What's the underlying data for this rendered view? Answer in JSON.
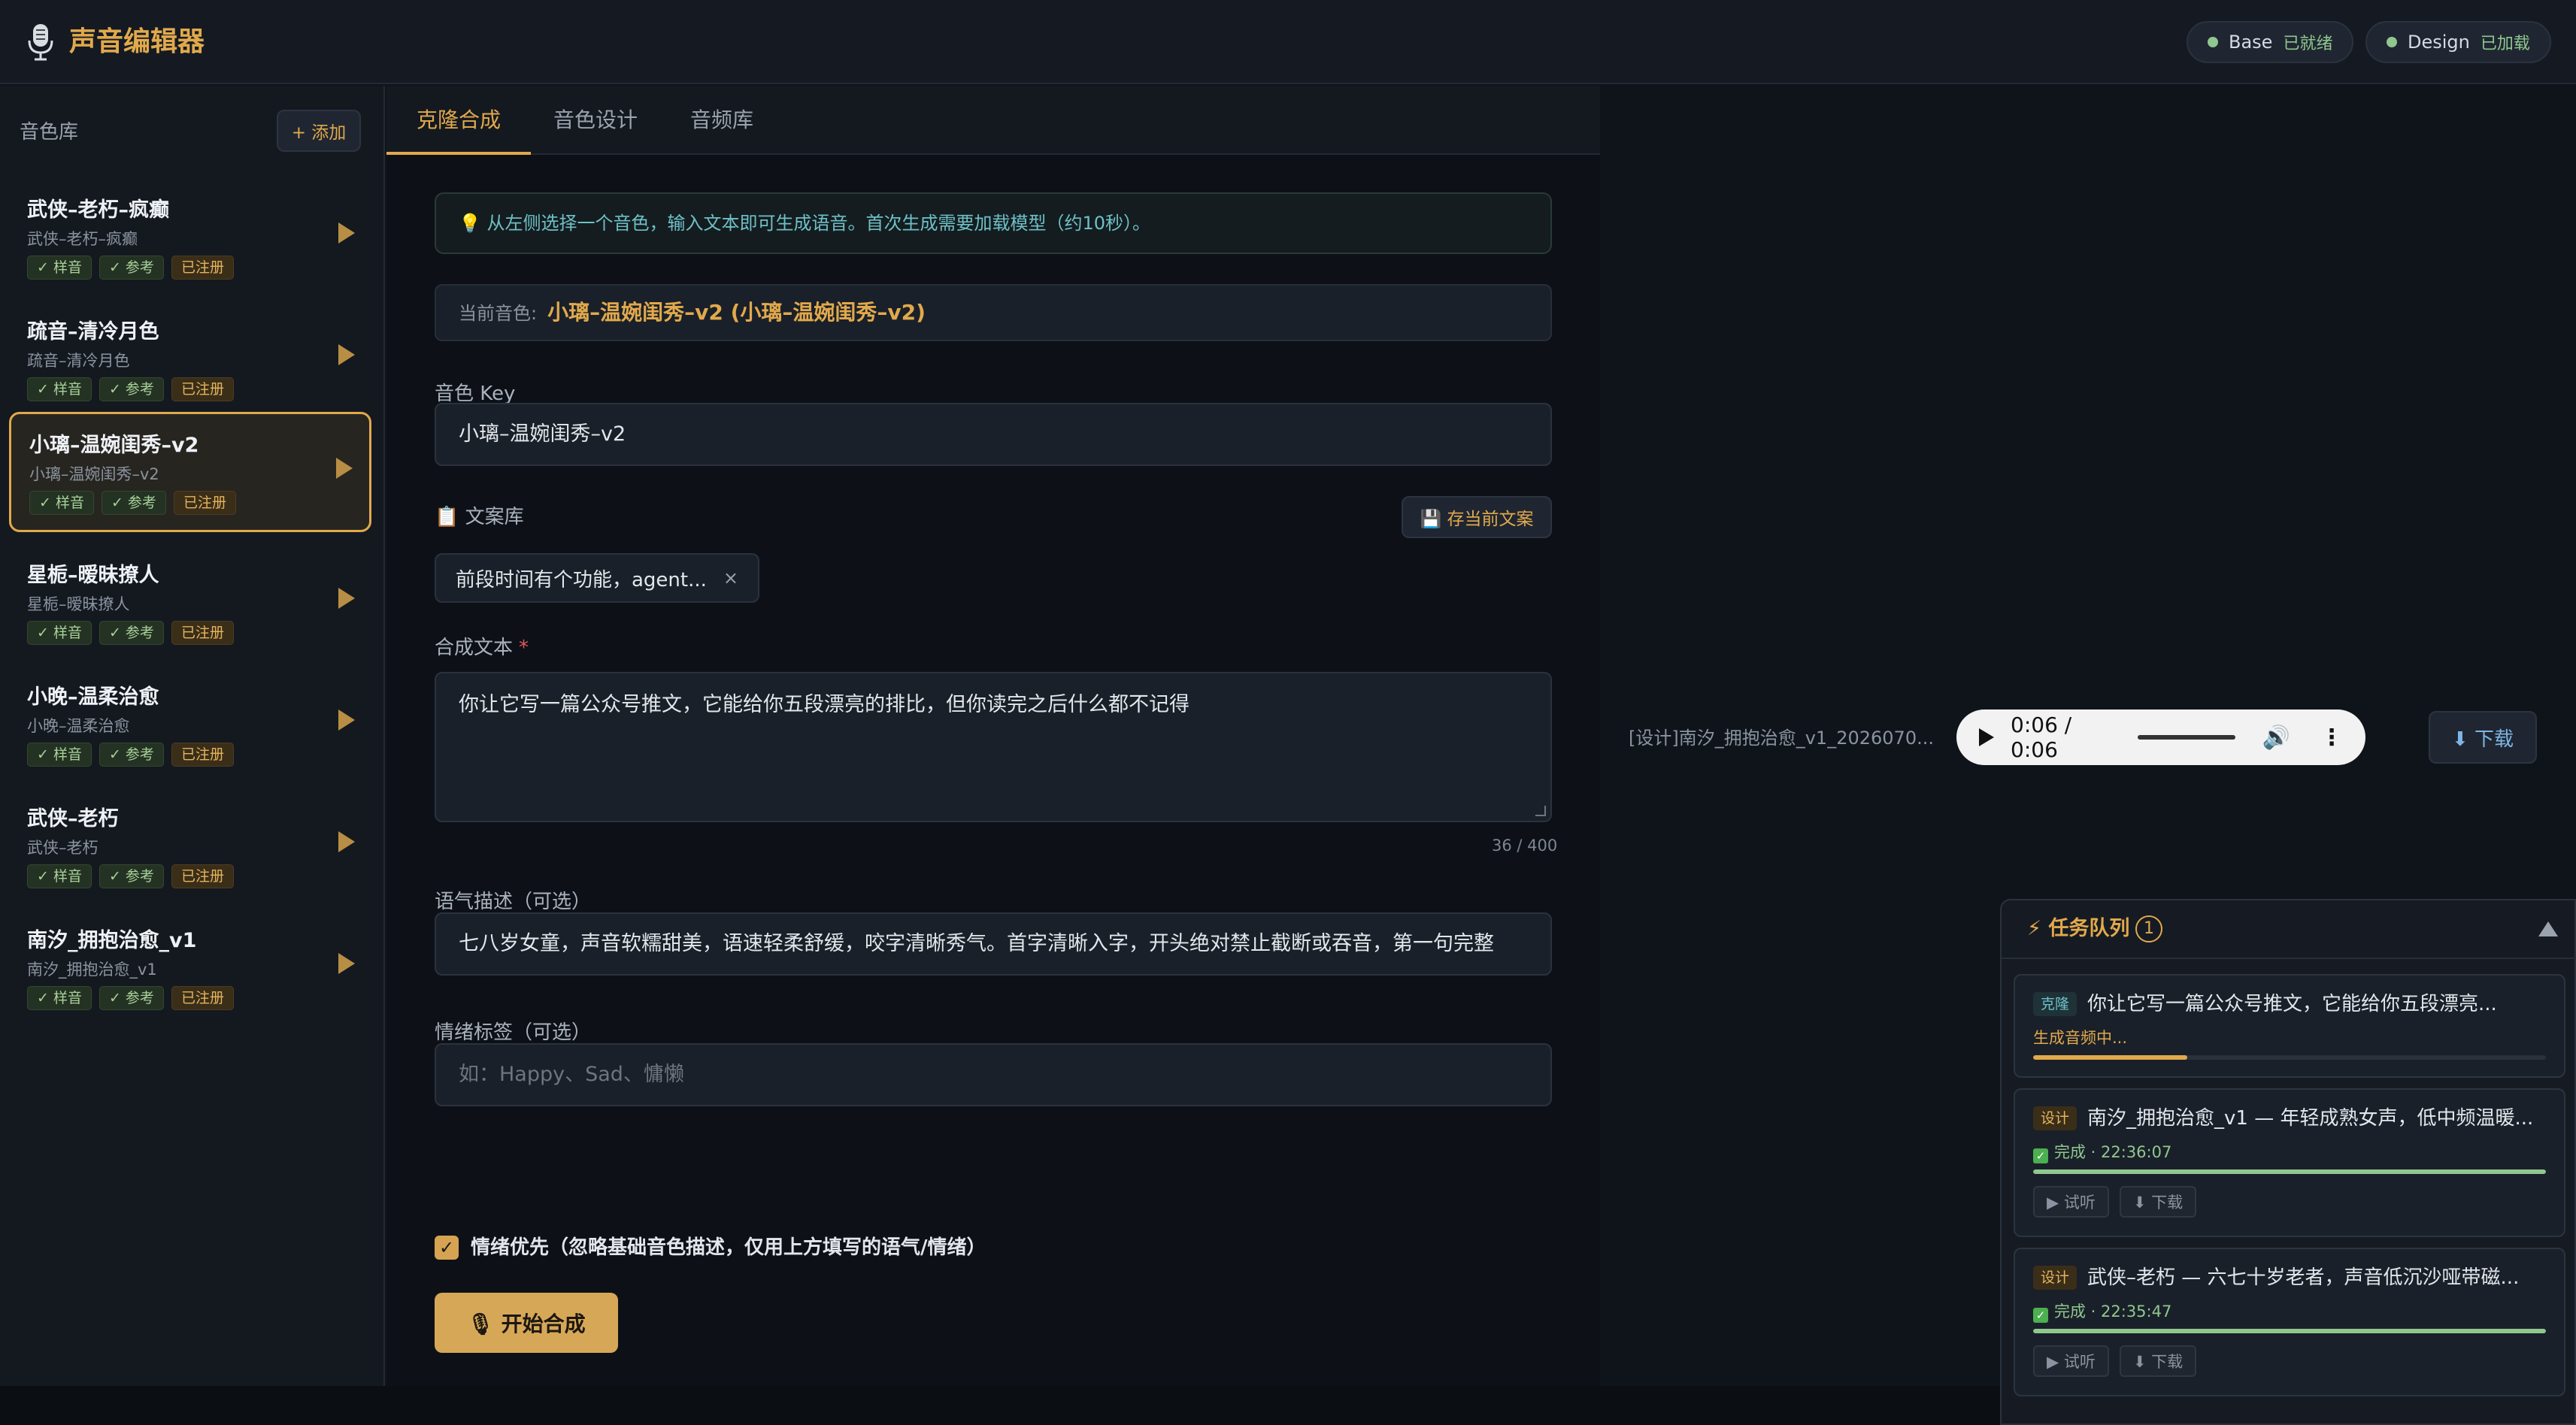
{
  "app": {
    "title": "声音编辑器",
    "logo_icon": "microphone-icon"
  },
  "status": [
    {
      "name": "Base",
      "state": "已就绪"
    },
    {
      "name": "Design",
      "state": "已加载"
    }
  ],
  "sidebar": {
    "title": "音色库",
    "add_label": "+ 添加",
    "items": [
      {
        "name": "武侠–老朽–疯癫",
        "sub": "武侠–老朽–疯癫",
        "tags": [
          "✓ 样音",
          "✓ 参考",
          "已注册"
        ],
        "active": false
      },
      {
        "name": "疏音–清冷月色",
        "sub": "疏音–清冷月色",
        "tags": [
          "✓ 样音",
          "✓ 参考",
          "已注册"
        ],
        "active": false
      },
      {
        "name": "小璃–温婉闺秀–v2",
        "sub": "小璃–温婉闺秀–v2",
        "tags": [
          "✓ 样音",
          "✓ 参考",
          "已注册"
        ],
        "active": true
      },
      {
        "name": "星栀–暧昧撩人",
        "sub": "星栀–暧昧撩人",
        "tags": [
          "✓ 样音",
          "✓ 参考",
          "已注册"
        ],
        "active": false
      },
      {
        "name": "小晚–温柔治愈",
        "sub": "小晚–温柔治愈",
        "tags": [
          "✓ 样音",
          "✓ 参考",
          "已注册"
        ],
        "active": false
      },
      {
        "name": "武侠–老朽",
        "sub": "武侠–老朽",
        "tags": [
          "✓ 样音",
          "✓ 参考",
          "已注册"
        ],
        "active": false
      },
      {
        "name": "南汐_拥抱治愈_v1",
        "sub": "南汐_拥抱治愈_v1",
        "tags": [
          "✓ 样音",
          "✓ 参考",
          "已注册"
        ],
        "active": false
      }
    ]
  },
  "tabs": [
    "克隆合成",
    "音色设计",
    "音频库"
  ],
  "clone": {
    "hint": "💡 从左侧选择一个音色，输入文本即可生成语音。首次生成需要加载模型（约10秒）。",
    "current_label": "当前音色:",
    "current_value": "小璃–温婉闺秀–v2 (小璃–温婉闺秀–v2)",
    "key_label": "音色 Key",
    "key_value": "小璃–温婉闺秀–v2",
    "library_label": "📋 文案库",
    "save_label": "💾 存当前文案",
    "chip_text": "前段时间有个功能，agent...",
    "chip_close": "×",
    "text_label": "合成文本",
    "text_required": "*",
    "text_value": "你让它写一篇公众号推文，它能给你五段漂亮的排比，但你读完之后什么都不记得",
    "counter": "36 / 400",
    "tone_label": "语气描述（可选）",
    "tone_value": "七八岁女童，声音软糯甜美，语速轻柔舒缓，咬字清晰秀气。首字清晰入字，开头绝对禁止截断或吞音，第一句完整",
    "emotion_label": "情绪标签（可选）",
    "emotion_placeholder": "如：Happy、Sad、慵懒",
    "check_label": "情绪优先（忽略基础音色描述，仅用上方填写的语气/情绪）",
    "start_label": "🎙 开始合成"
  },
  "player": {
    "file_name": "[设计]南汐_拥抱治愈_v1_2026070...",
    "time": "0:06 / 0:06",
    "download_label": "⬇ 下载"
  },
  "queue": {
    "title": "⚡ 任务队列",
    "count": "1",
    "tasks": [
      {
        "type": "克隆",
        "kind": "clone",
        "text": "你让它写一篇公众号推文，它能给你五段漂亮...",
        "status": "生成音频中...",
        "done": false,
        "progress": 0.3
      },
      {
        "type": "设计",
        "kind": "design",
        "text": "南汐_拥抱治愈_v1 — 年轻成熟女声，低中频温暖...",
        "status": "完成 · 22:36:07",
        "done": true,
        "progress": 1.0,
        "play": "▶ 试听",
        "download": "⬇ 下载"
      },
      {
        "type": "设计",
        "kind": "design",
        "text": "武侠–老朽 — 六七十岁老者，声音低沉沙哑带磁...",
        "status": "完成 · 22:35:47",
        "done": true,
        "progress": 1.0,
        "play": "▶ 试听",
        "download": "⬇ 下载"
      }
    ]
  },
  "colors": {
    "accent": "#e1a94c",
    "ok": "#8fc78f",
    "info": "#6ec0c7"
  }
}
